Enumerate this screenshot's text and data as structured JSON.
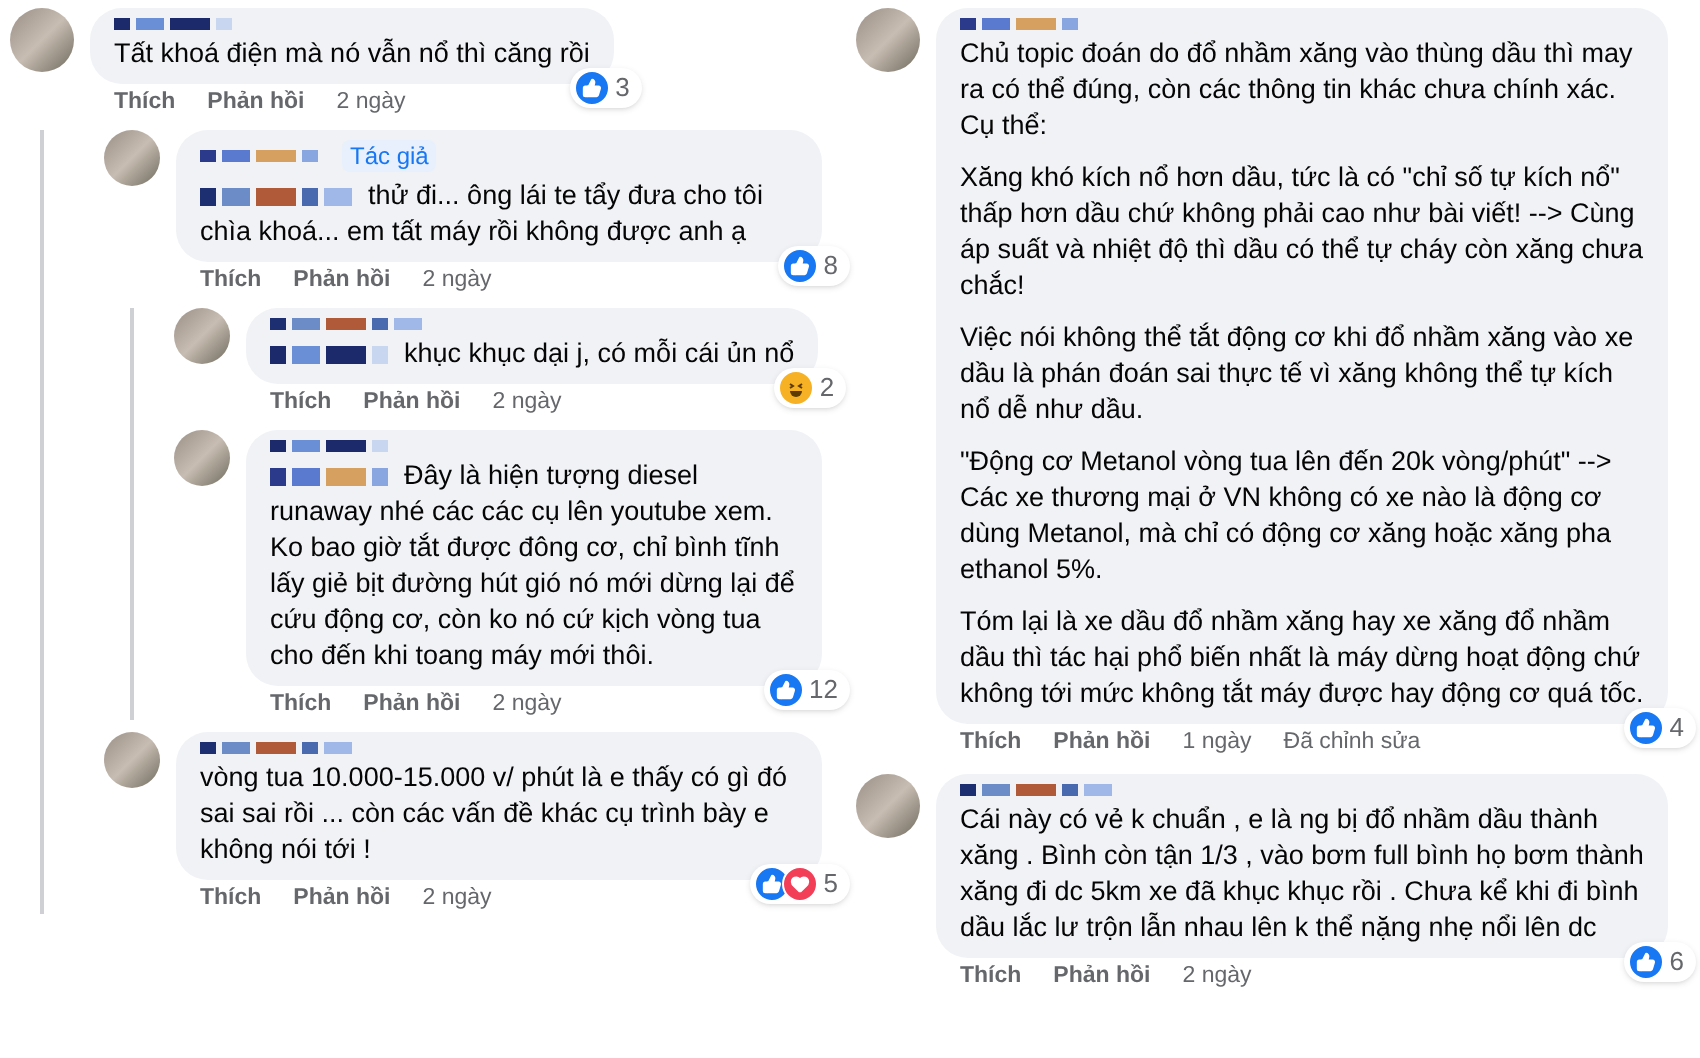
{
  "columns": [
    {
      "comments": [
        {
          "blurred_mention": false,
          "paragraphs": [
            "Tất khoá điện mà nó vẫn nổ thì căng rồi"
          ],
          "reactions": {
            "types": [
              {
                "kind": "like"
              }
            ],
            "count": "3"
          },
          "actions": [
            "Thích",
            "Phản hồi"
          ],
          "time": "2 ngày",
          "children": [
            {
              "author_badge": "Tác giả",
              "blurred_mention": true,
              "paragraphs": [
                "thử đi... ông lái te tẩy đưa cho tôi chìa khoá... em tất máy rồi không được anh ạ"
              ],
              "reactions": {
                "types": [
                  {
                    "kind": "like"
                  }
                ],
                "count": "8"
              },
              "actions": [
                "Thích",
                "Phản hồi"
              ],
              "time": "2 ngày",
              "children": [
                {
                  "blurred_mention": true,
                  "paragraphs": [
                    "khục khục dại j, có mỗi cái ủn nổ"
                  ],
                  "reactions": {
                    "types": [
                      {
                        "kind": "haha"
                      }
                    ],
                    "count": "2"
                  },
                  "actions": [
                    "Thích",
                    "Phản hồi"
                  ],
                  "time": "2 ngày"
                },
                {
                  "blurred_mention": true,
                  "paragraphs": [
                    "Đây là hiện tượng diesel runaway nhé các các cụ lên youtube xem. Ko bao giờ tắt được đông cơ, chỉ bình tĩnh lấy giẻ bịt đường hút gió nó mới dừng lại để cứu động cơ, còn ko nó cứ kịch vòng tua cho đến khi toang máy mới thôi."
                  ],
                  "reactions": {
                    "types": [
                      {
                        "kind": "like"
                      }
                    ],
                    "count": "12"
                  },
                  "actions": [
                    "Thích",
                    "Phản hồi"
                  ],
                  "time": "2 ngày"
                }
              ]
            },
            {
              "blurred_mention": false,
              "paragraphs": [
                "vòng tua 10.000-15.000 v/ phút là e thấy có gì đó sai sai rồi ... còn các vấn đề khác cụ trình bày e không nói tới !"
              ],
              "reactions": {
                "types": [
                  {
                    "kind": "like"
                  },
                  {
                    "kind": "love"
                  }
                ],
                "count": "5"
              },
              "actions": [
                "Thích",
                "Phản hồi"
              ],
              "time": "2 ngày"
            }
          ]
        }
      ]
    },
    {
      "comments": [
        {
          "blurred_mention": false,
          "paragraphs": [
            "Chủ topic đoán do đổ nhầm xăng vào thùng dầu thì may ra có thể đúng, còn các thông tin khác chưa chính xác. Cụ thể:",
            "Xăng khó kích nổ hơn dầu, tức là có \"chỉ số tự kích nổ\" thấp hơn dầu chứ không phải cao như bài viết! --> Cùng áp suất và nhiệt độ thì dầu có thể tự cháy còn xăng chưa chắc!",
            "Việc nói không thể tắt động cơ khi đổ nhầm xăng vào xe dầu là phán đoán sai thực tế vì xăng không thể tự kích nổ dễ như dầu.",
            "\"Động cơ Metanol vòng tua lên đến 20k vòng/phút\" --> Các xe thương mại ở VN không có xe nào là động cơ dùng Metanol, mà chỉ có động cơ xăng hoặc xăng pha ethanol 5%.",
            "Tóm lại là xe dầu đổ nhầm xăng hay xe xăng đổ nhầm dầu thì tác hại phổ biến nhất là máy dừng hoạt động chứ không tới mức không tắt máy được hay động cơ quá tốc."
          ],
          "reactions": {
            "types": [
              {
                "kind": "like"
              }
            ],
            "count": "4"
          },
          "actions": [
            "Thích",
            "Phản hồi"
          ],
          "time": "1 ngày",
          "edited": "Đã chỉnh sửa"
        },
        {
          "blurred_mention": false,
          "paragraphs": [
            "Cái này có vẻ k chuẩn , e là ng bị đổ nhầm dầu thành xăng . Bình còn tận 1/3 , vào bơm full bình họ bơm thành xăng đi dc 5km xe đã khục khục rồi . Chưa kể khi đi bình dầu lắc lư trộn lẫn nhau lên k thể nặng nhẹ nổi lên dc"
          ],
          "reactions": {
            "types": [
              {
                "kind": "like"
              }
            ],
            "count": "6"
          },
          "actions": [
            "Thích",
            "Phản hồi"
          ],
          "time": "2 ngày"
        }
      ]
    }
  ]
}
